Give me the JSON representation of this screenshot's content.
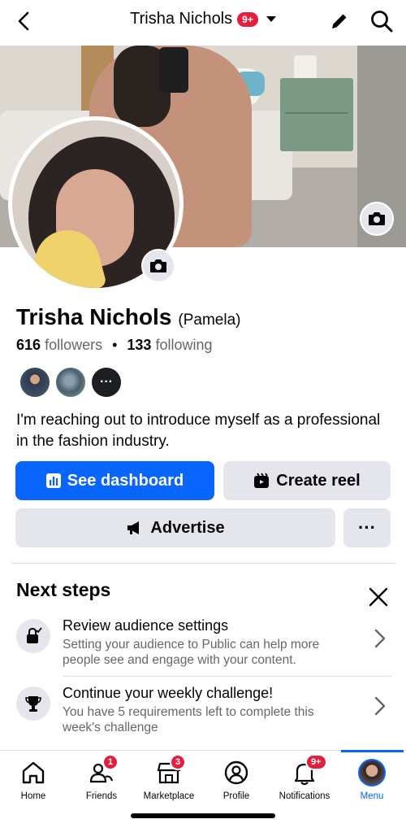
{
  "header": {
    "title": "Trisha Nichols",
    "notif_badge": "9+"
  },
  "profile": {
    "name": "Trisha Nichols",
    "alt_name": "(Pamela)",
    "followers_count": "616",
    "followers_label": "followers",
    "following_count": "133",
    "following_label": "following",
    "separator": "•",
    "mutual_more": "···",
    "bio": "I'm reaching out to introduce myself as a professional in the fashion industry."
  },
  "actions": {
    "dashboard_label": "See dashboard",
    "reel_label": "Create reel",
    "advertise_label": "Advertise",
    "more_label": "···"
  },
  "next_steps": {
    "title": "Next steps",
    "items": [
      {
        "title": "Review audience settings",
        "desc": "Setting your audience to Public can help more people see and engage with your content.",
        "icon": "lock-check-icon"
      },
      {
        "title": "Continue your weekly challenge!",
        "desc": "You have 5 requirements left to complete this week's challenge",
        "icon": "trophy-icon"
      }
    ]
  },
  "bottom_nav": {
    "items": [
      {
        "label": "Home",
        "badge": ""
      },
      {
        "label": "Friends",
        "badge": "1"
      },
      {
        "label": "Marketplace",
        "badge": "3"
      },
      {
        "label": "Profile",
        "badge": ""
      },
      {
        "label": "Notifications",
        "badge": "9+"
      },
      {
        "label": "Menu",
        "badge": ""
      }
    ],
    "active": "Menu"
  },
  "colors": {
    "accent": "#0866ff",
    "badge": "#e41e3f",
    "secondary_button": "#e4e6eb",
    "muted_text": "#65676b"
  }
}
